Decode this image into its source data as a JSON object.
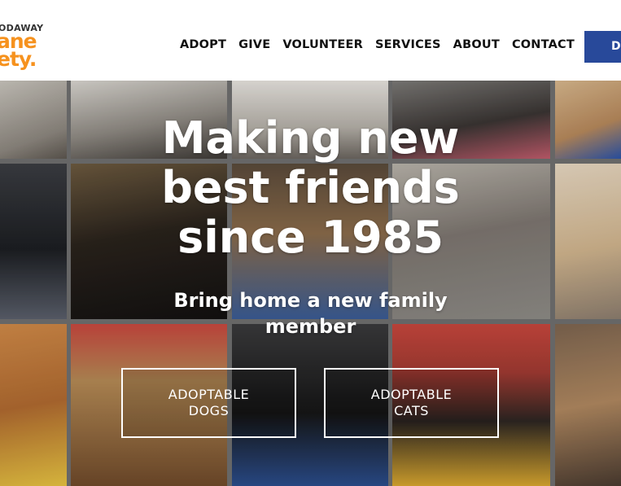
{
  "header": {
    "logo_top": "ODAWAY",
    "logo_mid": "ane",
    "logo_bot": "ety."
  },
  "nav": {
    "items": [
      "ADOPT",
      "GIVE",
      "VOLUNTEER",
      "SERVICES",
      "ABOUT",
      "CONTACT"
    ]
  },
  "donate": {
    "label": "DONATE"
  },
  "hero": {
    "title_lines": [
      "Making new",
      "best friends",
      "since 1985"
    ],
    "subtitle": "Bring home a new family member",
    "buttons": [
      {
        "line1": "ADOPTABLE",
        "line2": "DOGS"
      },
      {
        "line1": "ADOPTABLE",
        "line2": "CATS"
      }
    ]
  },
  "colors": {
    "brand_orange": "#f6921e",
    "donate_blue": "#28499a",
    "nav_text": "#111111",
    "hero_text": "#ffffff"
  }
}
